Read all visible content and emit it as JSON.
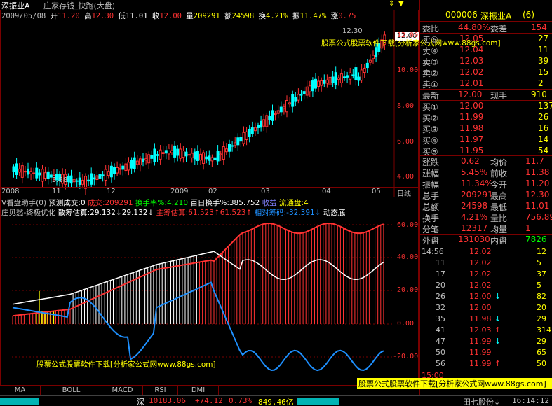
{
  "colors": {
    "up": "#ff3232",
    "down": "#00ffff",
    "flat": "#c0c0c0",
    "yellow": "#ffff00",
    "grid": "#7a0000",
    "white": "#ffffff"
  },
  "header": {
    "market": "深振业A",
    "indicator_name": "庄家存钱_快跑(大盘)",
    "date": "2009/05/08",
    "open_label": "开",
    "open": "11.20",
    "high_label": "高",
    "high": "12.30",
    "low_label": "低",
    "low": "11.01",
    "close_label": "收",
    "close": "12.00",
    "volume_label": "量",
    "volume": "209291",
    "amount_label": "额",
    "amount": "24598",
    "turnover_label": "换",
    "turnover": "4.21%",
    "amplitude_label": "振",
    "amplitude": "11.47%",
    "change_label": "涨",
    "change": "0.75",
    "watermark_top": "股票公式股票软件下载[分析家公式网www.88gs.com]",
    "price_callout": "12.00",
    "high_callout": "12.30",
    "low_callout": "3.88"
  },
  "main_axis": {
    "labels": [
      "12.00",
      "10.00",
      "8.00",
      "6.00",
      "4.00"
    ]
  },
  "date_axis": {
    "labels": [
      "2008",
      "11",
      "12",
      "2009",
      "02",
      "03",
      "04",
      "05"
    ],
    "right_label": "日线"
  },
  "sub_panel": {
    "line1_name": "V看盘助手(0)",
    "line1_a": "预测成交:0",
    "line1_b": "成交:209291",
    "line1_c": "换手率%:4.210",
    "line1_d": "百日换手%:385.752",
    "line1_e": "收益",
    "line1_f": "流通盘:4",
    "line2_name": "庄见愁-终极优化",
    "line2_a": "散筹估算:29.132",
    "line2_b": "29.132",
    "line2_c": "主筹估算:61.523",
    "line2_d": "61.523",
    "line2_e": "相对筹码:-32.391",
    "line2_f": "动态底",
    "axis": [
      "60.00",
      "40.00",
      "20.00",
      "0.00",
      "-20.00"
    ],
    "watermark": "股票公式股票软件下载[分析家公式网www.88gs.com]"
  },
  "tabs": [
    "MA",
    "BOLL",
    "MACD",
    "RSI",
    "DMI"
  ],
  "right_panel": {
    "code": "000006",
    "name": "深振业A",
    "badge": "(6)",
    "weibi_label": "委比",
    "weibi": "44.80%",
    "weicha_label": "委差",
    "weicha": "154",
    "asks": [
      {
        "label": "卖⑤",
        "price": "12.05",
        "vol": ""
      },
      {
        "label": "卖④",
        "price": "12.04",
        "vol": "11"
      },
      {
        "label": "卖③",
        "price": "12.03",
        "vol": "39"
      },
      {
        "label": "卖②",
        "price": "12.02",
        "vol": "15"
      },
      {
        "label": "卖①",
        "price": "12.01",
        "vol": "2"
      }
    ],
    "ask5_vol": "27",
    "latest_label": "最新",
    "latest": "12.00",
    "xianshou_label": "现手",
    "xianshou": "910",
    "bids": [
      {
        "label": "买①",
        "price": "12.00",
        "vol": "137"
      },
      {
        "label": "买②",
        "price": "11.99",
        "vol": "26"
      },
      {
        "label": "买③",
        "price": "11.98",
        "vol": "16"
      },
      {
        "label": "买④",
        "price": "11.97",
        "vol": "14"
      },
      {
        "label": "买⑤",
        "price": "11.95",
        "vol": "54"
      }
    ],
    "stats": [
      {
        "l1": "涨跌",
        "v1": "0.62",
        "l2": "均价",
        "v2": "11.7"
      },
      {
        "l1": "涨幅",
        "v1": "5.45%",
        "l2": "前收",
        "v2": "11.38"
      },
      {
        "l1": "振幅",
        "v1": "11.34%",
        "l2": "今开",
        "v2": "11.20"
      },
      {
        "l1": "总手",
        "v1": "209291",
        "l2": "最高",
        "v2": "12.30"
      },
      {
        "l1": "总额",
        "v1": "24598",
        "l2": "最低",
        "v2": "11.01"
      },
      {
        "l1": "换手",
        "v1": "4.21%",
        "l2": "量比",
        "v2": "756.89"
      },
      {
        "l1": "分笔",
        "v1": "12317",
        "l2": "均量",
        "v2": "1"
      }
    ],
    "outer_label": "外盘",
    "outer": "131030",
    "inner_label": "内盘",
    "inner": "7826",
    "ticks": [
      {
        "t": "14:56",
        "p": "12.02",
        "arrow": "",
        "v": "12"
      },
      {
        "t": "11",
        "p": "12.02",
        "arrow": "",
        "v": "5"
      },
      {
        "t": "17",
        "p": "12.02",
        "arrow": "",
        "v": "37"
      },
      {
        "t": "20",
        "p": "12.02",
        "arrow": "",
        "v": "5"
      },
      {
        "t": "26",
        "p": "12.00",
        "arrow": "↓",
        "v": "82"
      },
      {
        "t": "32",
        "p": "12.00",
        "arrow": "",
        "v": "20"
      },
      {
        "t": "35",
        "p": "11.98",
        "arrow": "↓",
        "v": "29"
      },
      {
        "t": "41",
        "p": "12.03",
        "arrow": "↑",
        "v": "314"
      },
      {
        "t": "47",
        "p": "11.99",
        "arrow": "↓",
        "v": "29"
      },
      {
        "t": "50",
        "p": "11.99",
        "arrow": "",
        "v": "65"
      },
      {
        "t": "56",
        "p": "11.99",
        "arrow": "↑",
        "v": "50"
      }
    ],
    "tick_last_time": "15:00"
  },
  "statusbar": {
    "market": "深",
    "index": "10183.06",
    "change": "+74.12",
    "pct": "0.73%",
    "amount": "849.46亿",
    "stock": "田七股份↓",
    "time": "16:14:12"
  }
}
